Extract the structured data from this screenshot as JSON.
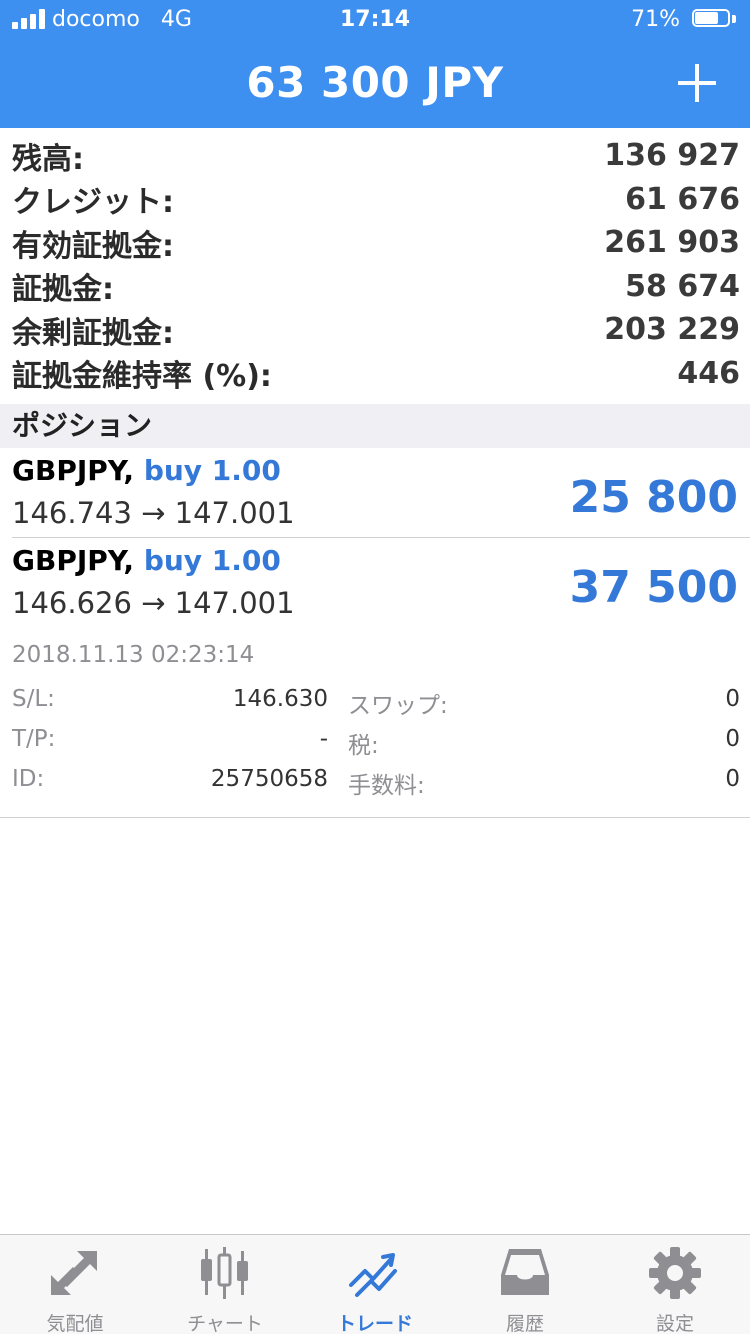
{
  "status_bar": {
    "carrier": "docomo",
    "network": "4G",
    "time": "17:14",
    "battery": "71%",
    "battery_level": 0.71
  },
  "header": {
    "title": "63 300 JPY",
    "add_icon": "plus-icon"
  },
  "account": [
    {
      "label": "残高:",
      "value": "136 927"
    },
    {
      "label": "クレジット:",
      "value": "61 676"
    },
    {
      "label": "有効証拠金:",
      "value": "261 903"
    },
    {
      "label": "証拠金:",
      "value": "58 674"
    },
    {
      "label": "余剰証拠金:",
      "value": "203 229"
    },
    {
      "label": "証拠金維持率 (%):",
      "value": "446"
    }
  ],
  "positions_header": "ポジション",
  "positions": [
    {
      "symbol": "GBPJPY,",
      "trade": "buy 1.00",
      "prices": "146.743 → 147.001",
      "profit": "25 800"
    },
    {
      "symbol": "GBPJPY,",
      "trade": "buy 1.00",
      "prices": "146.626 → 147.001",
      "profit": "37 500"
    }
  ],
  "position_detail": {
    "opened": "2018.11.13 02:23:14",
    "rows": [
      {
        "k1": "S/L:",
        "v1": "146.630",
        "k2": "スワップ:",
        "v2": "0"
      },
      {
        "k1": "T/P:",
        "v1": "-",
        "k2": "税:",
        "v2": "0"
      },
      {
        "k1": "ID:",
        "v1": "25750658",
        "k2": "手数料:",
        "v2": "0"
      }
    ]
  },
  "tabs": [
    {
      "label": "気配値",
      "icon": "quotes-arrows-icon",
      "active": false
    },
    {
      "label": "チャート",
      "icon": "candlestick-chart-icon",
      "active": false
    },
    {
      "label": "トレード",
      "icon": "trade-chart-icon",
      "active": true
    },
    {
      "label": "履歴",
      "icon": "history-inbox-icon",
      "active": false
    },
    {
      "label": "設定",
      "icon": "gear-icon",
      "active": false
    }
  ],
  "colors": {
    "header_blue": "#3d8ff0",
    "accent_blue": "#3478d8",
    "tab_inactive": "#8e8e93",
    "section_bg": "#efeff4"
  }
}
